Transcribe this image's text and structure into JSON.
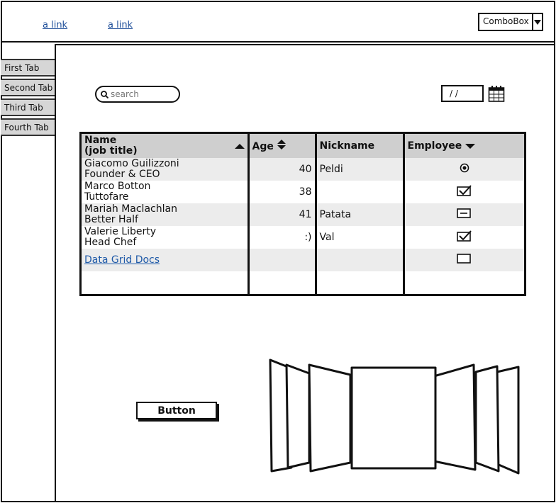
{
  "header": {
    "links": [
      "a link",
      "a link"
    ],
    "combobox": {
      "value": "ComboBox"
    }
  },
  "tabs": [
    "First Tab",
    "Second Tab",
    "Third Tab",
    "Fourth Tab"
  ],
  "toolbar": {
    "search_placeholder": "search",
    "date_value": "/ /"
  },
  "grid": {
    "columns": [
      {
        "label": "Name\n(job title)",
        "sort": "ascending"
      },
      {
        "label": "Age",
        "sort": "both"
      },
      {
        "label": "Nickname"
      },
      {
        "label": "Employee",
        "sort": "descending"
      }
    ],
    "rows": [
      {
        "name": "Giacomo Guilizzoni",
        "title": "Founder & CEO",
        "age": "40",
        "nickname": "Peldi",
        "employee": "radio-selected"
      },
      {
        "name": "Marco Botton",
        "title": "Tuttofare",
        "age": "38",
        "nickname": "",
        "employee": "checked"
      },
      {
        "name": "Mariah Maclachlan",
        "title": "Better Half",
        "age": "41",
        "nickname": "Patata",
        "employee": "indeterminate"
      },
      {
        "name": "Valerie Liberty",
        "title": "Head Chef",
        "age": ":)",
        "nickname": "Val",
        "employee": "checked"
      }
    ],
    "link_row": {
      "label": "Data Grid Docs",
      "employee": "unchecked"
    }
  },
  "button": {
    "label": "Button"
  },
  "cover_flow": {
    "icon": "cover-flow-icon"
  }
}
